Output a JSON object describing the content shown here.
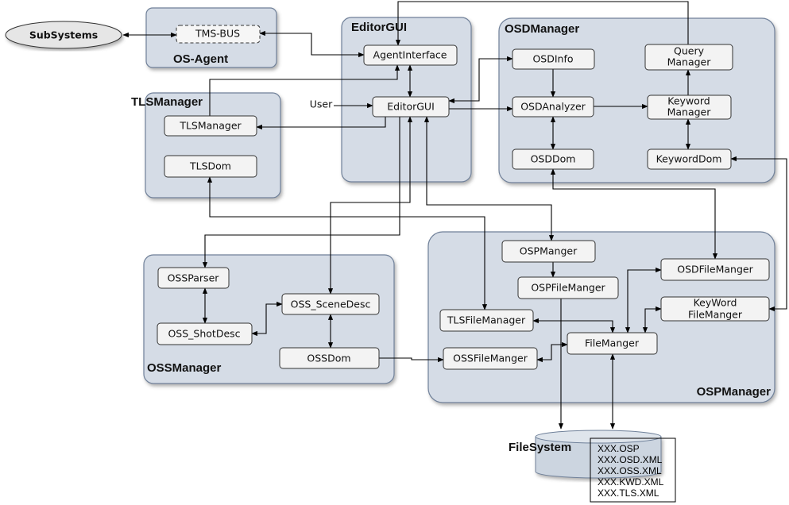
{
  "external": {
    "subsystems": "SubSystems",
    "user": "User"
  },
  "groups": {
    "os_agent": {
      "title": "OS-Agent",
      "components": {
        "tms_bus": "TMS-BUS"
      }
    },
    "editor_gui": {
      "title": "EditorGUI",
      "components": {
        "agent_interface": "AgentInterface",
        "editor_gui": "EditorGUI"
      }
    },
    "osd_manager": {
      "title": "OSDManager",
      "components": {
        "osd_info": "OSDInfo",
        "query_manager_1": "Query",
        "query_manager_2": "Manager",
        "osd_analyzer": "OSDAnalyzer",
        "keyword_manager_1": "Keyword",
        "keyword_manager_2": "Manager",
        "osd_dom": "OSDDom",
        "keyword_dom": "KeywordDom"
      }
    },
    "tls_manager": {
      "title": "TLSManager",
      "components": {
        "tls_manager": "TLSManager",
        "tls_dom": "TLSDom"
      }
    },
    "oss_manager": {
      "title": "OSSManager",
      "components": {
        "oss_parser": "OSSParser",
        "oss_shot_desc": "OSS_ShotDesc",
        "oss_scene_desc": "OSS_SceneDesc",
        "oss_dom": "OSSDom"
      }
    },
    "osp_manager": {
      "title": "OSPManager",
      "components": {
        "osp_manger": "OSPManger",
        "osp_file_manger": "OSPFileManger",
        "osd_file_manger": "OSDFileManger",
        "tls_file_manager": "TLSFileManager",
        "keyword_file_manger_1": "KeyWord",
        "keyword_file_manger_2": "FileManger",
        "file_manger": "FileManger",
        "oss_file_manger": "OSSFileManger"
      }
    }
  },
  "file_system": {
    "title": "FileSystem",
    "files": [
      "XXX.OSP",
      "XXX.OSD.XML",
      "XXX.OSS.XML",
      "XXX.KWD.XML",
      "XXX.TLS.XML"
    ]
  }
}
